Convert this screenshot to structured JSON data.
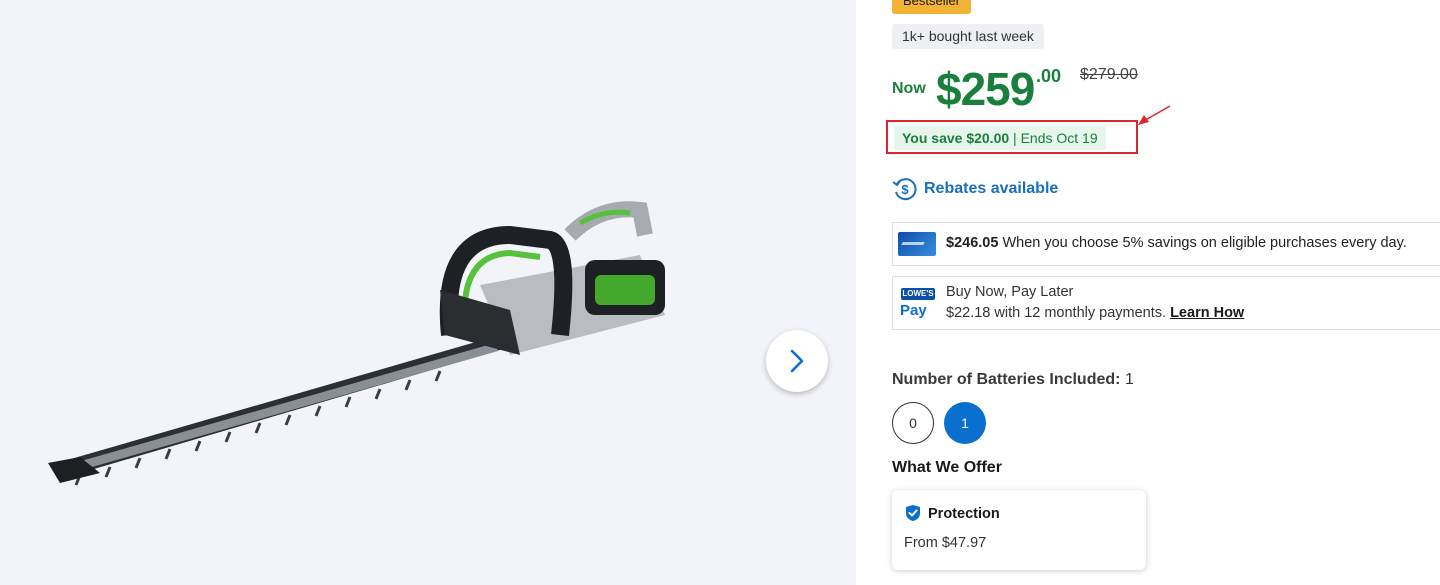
{
  "badges": {
    "bestseller": "Bestseller",
    "bought": "1k+ bought last week"
  },
  "price": {
    "now_label": "Now",
    "dollars": "$259",
    "cents": ".00",
    "was": "$279.00"
  },
  "savings": {
    "amount_text": "You save $20.00",
    "separator": "|",
    "ends_text": "Ends Oct 19"
  },
  "rebates": {
    "label": "Rebates available"
  },
  "card_offer": {
    "amount": "$246.05",
    "text": "When you choose 5% savings on eligible purchases every day."
  },
  "pay_later": {
    "logo_top": "LOWE'S",
    "logo_bottom": "Pay",
    "line1": "Buy Now, Pay Later",
    "line2": "$22.18 with 12 monthly payments.",
    "link": "Learn How"
  },
  "batteries": {
    "label": "Number of Batteries Included:",
    "selected_value": "1",
    "options": [
      "0",
      "1"
    ]
  },
  "what_we_offer": {
    "heading": "What We Offer",
    "protection_title": "Protection",
    "protection_price": "From $47.97"
  },
  "icons": [
    "chevron-right-icon",
    "rebate-dollar-icon",
    "card-icon",
    "lowes-pay-icon",
    "check-badge-icon",
    "red-arrow-icon"
  ],
  "colors": {
    "price_green": "#1a7f3c",
    "brand_blue": "#0b6fd0",
    "highlight_red": "#d8262c",
    "bestseller_gold": "#f2b233"
  }
}
